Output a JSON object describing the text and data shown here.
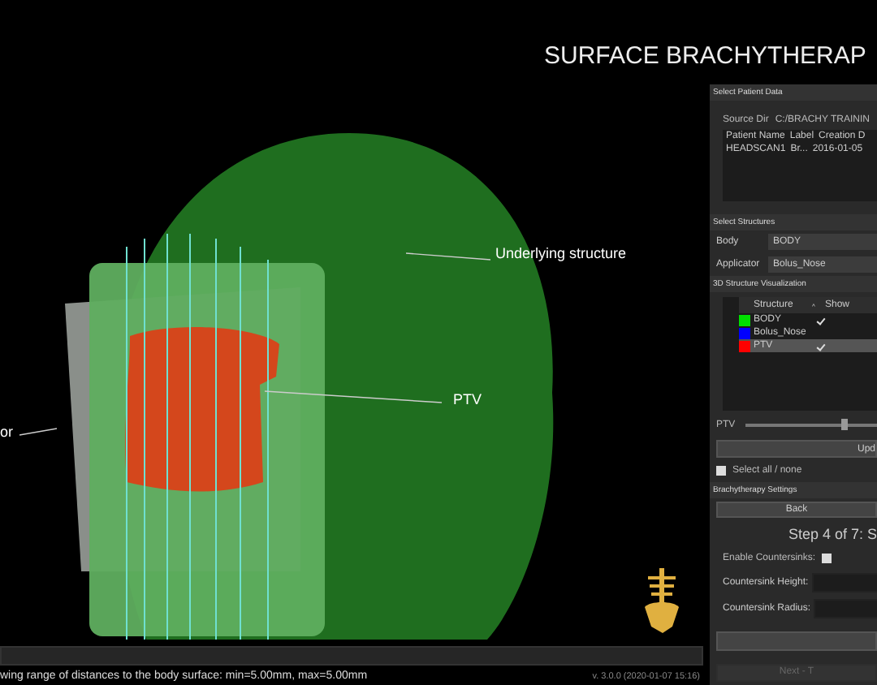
{
  "title": "SURFACE BRACHYTHERAP",
  "viewport": {
    "annotations": [
      {
        "text": "Underlying structure"
      },
      {
        "text": "PTV"
      },
      {
        "text": "or"
      }
    ]
  },
  "status": {
    "message": "wing range of distances to the body surface: min=5.00mm, max=5.00mm",
    "version": "v. 3.0.0 (2020-01-07 15:16)"
  },
  "patient": {
    "heading": "Select Patient Data",
    "source_label": "Source Dir",
    "source_value": "C:/BRACHY TRAININ",
    "columns": [
      "Patient Name",
      "Label",
      "Creation D"
    ],
    "rows": [
      {
        "cells": [
          "HEADSCAN1",
          "Br...",
          "2016-01-05"
        ],
        "selected": false
      }
    ]
  },
  "structures": {
    "heading": "Select Structures",
    "fields": [
      {
        "label": "Body",
        "value": "BODY"
      },
      {
        "label": "Applicator",
        "value": "Bolus_Nose"
      }
    ]
  },
  "visualization": {
    "heading": "3D Structure Visualization",
    "columns": [
      "Structure",
      "^",
      "Show"
    ],
    "rows": [
      {
        "name": "BODY",
        "color": "#00e000",
        "show": true,
        "selected": false
      },
      {
        "name": "Bolus_Nose",
        "color": "#0000ff",
        "show": false,
        "selected": false
      },
      {
        "name": "PTV",
        "color": "#ff0000",
        "show": true,
        "selected": true
      }
    ],
    "slider": {
      "label": "PTV",
      "level": 0.75
    },
    "update_button": "Upd",
    "select_all": {
      "label": "Select all / none",
      "checked": false
    }
  },
  "settings": {
    "heading": "Brachytherapy Settings",
    "back_button": "Back",
    "step": "Step 4 of 7: S",
    "countersinks": {
      "label": "Enable Countersinks:",
      "checked": false
    },
    "fields": [
      {
        "label": "Countersink Height:"
      },
      {
        "label": "Countersink Radius:"
      }
    ],
    "buttons": [
      {
        "disabled": false
      },
      {
        "label": "Next - T",
        "disabled": true
      }
    ]
  }
}
